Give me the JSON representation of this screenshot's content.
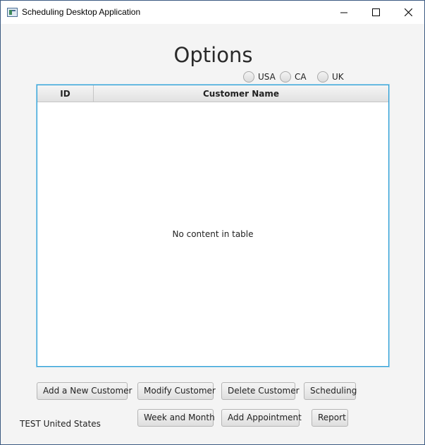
{
  "window": {
    "title": "Scheduling Desktop Application",
    "icon": "app-window-icon"
  },
  "main": {
    "heading": "Options",
    "regions": [
      {
        "label": "USA",
        "selected": false
      },
      {
        "label": "CA",
        "selected": false
      },
      {
        "label": "UK",
        "selected": false
      }
    ],
    "table": {
      "columns": [
        "ID",
        "Customer Name"
      ],
      "rows": [],
      "empty_message": "No content in table"
    },
    "buttons": {
      "add_customer": "Add a New Customer",
      "modify_customer": "Modify Customer",
      "delete_customer": "Delete Customer",
      "scheduling": "Scheduling",
      "week_month": "Week and Month",
      "add_appointment": "Add Appointment",
      "report": "Report"
    },
    "status": "TEST United States"
  },
  "colors": {
    "table_focus_border": "#2fa0d6",
    "background": "#f4f4f4"
  }
}
